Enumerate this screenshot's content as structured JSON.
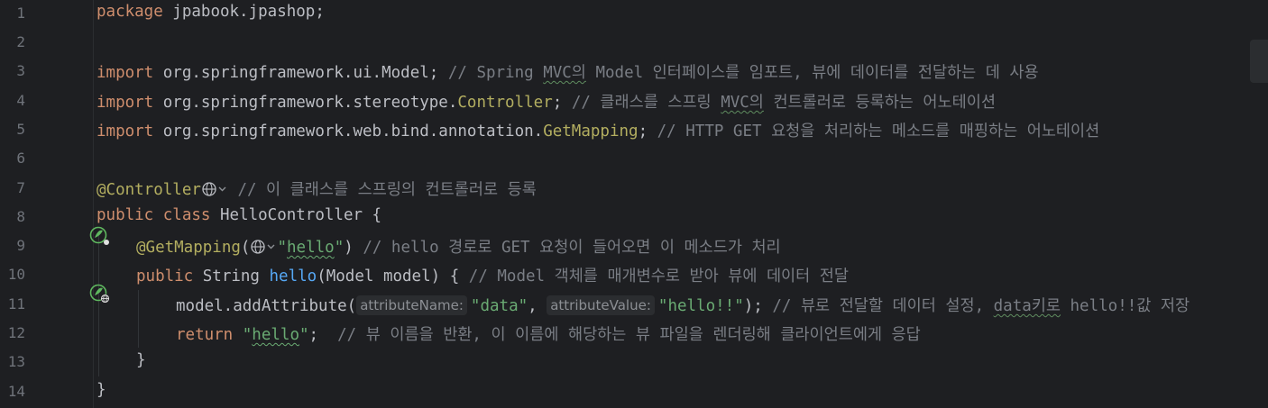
{
  "editor": {
    "lines": [
      {
        "num": "1"
      },
      {
        "num": "2"
      },
      {
        "num": "3"
      },
      {
        "num": "4"
      },
      {
        "num": "5"
      },
      {
        "num": "6"
      },
      {
        "num": "7"
      },
      {
        "num": "8"
      },
      {
        "num": "9"
      },
      {
        "num": "10"
      },
      {
        "num": "11"
      },
      {
        "num": "12"
      },
      {
        "num": "13"
      },
      {
        "num": "14"
      }
    ],
    "l1": {
      "kw": "package",
      "rest": " jpabook.jpashop;"
    },
    "l3": {
      "kw": "import",
      "rest": " org.springframework.ui.Model;",
      "cmt_a": " // Spring ",
      "cmt_b": "MVC의",
      "cmt_c": " Model 인터페이스를 임포트, 뷰에 데이터를 전달하는 데 사용"
    },
    "l4": {
      "kw": "import",
      "rest": " org.springframework.stereotype.",
      "cls": "Controller",
      "semi": ";",
      "cmt_a": " // 클래스를 스프링 ",
      "cmt_b": "MVC의",
      "cmt_c": " 컨트롤러로 등록하는 어노테이션"
    },
    "l5": {
      "kw": "import",
      "rest": " org.springframework.web.bind.annotation.",
      "cls": "GetMapping",
      "semi": ";",
      "cmt": " // HTTP GET 요청을 처리하는 메소드를 매핑하는 어노테이션"
    },
    "l7": {
      "ann": "@Controller",
      "cmt": " // 이 클래스를 스프링의 컨트롤러로 등록"
    },
    "l8": {
      "kw": "public class",
      "name": " HelloController {"
    },
    "l9": {
      "ann": "@GetMapping",
      "open": "(",
      "q1": "\"",
      "str": "hello",
      "q2": "\"",
      "close": ")",
      "cmt": " // hello 경로로 GET 요청이 들어오면 이 메소드가 처리"
    },
    "l10": {
      "kw": "public",
      "type": " String ",
      "fn": "hello",
      "params": "(Model model) {",
      "cmt": " // Model 객체를 매개변수로 받아 뷰에 데이터 전달"
    },
    "l11": {
      "call": "model.addAttribute(",
      "hint1": "attributeName:",
      "str1": "\"data\"",
      "comma": ", ",
      "hint2": "attributeValue:",
      "str2": "\"hello!!\"",
      "end": ");",
      "cmt_a": " // 뷰로 전달할 데이터 설정, ",
      "cmt_b": "data키로",
      "cmt_c": " hello!!값 저장"
    },
    "l12": {
      "kw": "return",
      "q1": " \"",
      "str": "hello",
      "q2": "\"",
      "semi": ";",
      "cmt": "  // 뷰 이름을 반환, 이 이름에 해당하는 뷰 파일을 렌더링해 클라이언트에게 응답"
    },
    "l13": {
      "text": "}"
    },
    "l14": {
      "text": "}"
    }
  },
  "icons": [
    "spring-bean-icon",
    "web-endpoint-icon",
    "globe-icon",
    "chevron-down-icon"
  ],
  "colors": {
    "background": "#1e1f22",
    "keyword": "#cf8e6d",
    "annotation": "#b3ae60",
    "string": "#6aab73",
    "comment": "#7a7e85",
    "method": "#56a8f5",
    "text": "#bcbec4",
    "line_number": "#6f737a"
  }
}
